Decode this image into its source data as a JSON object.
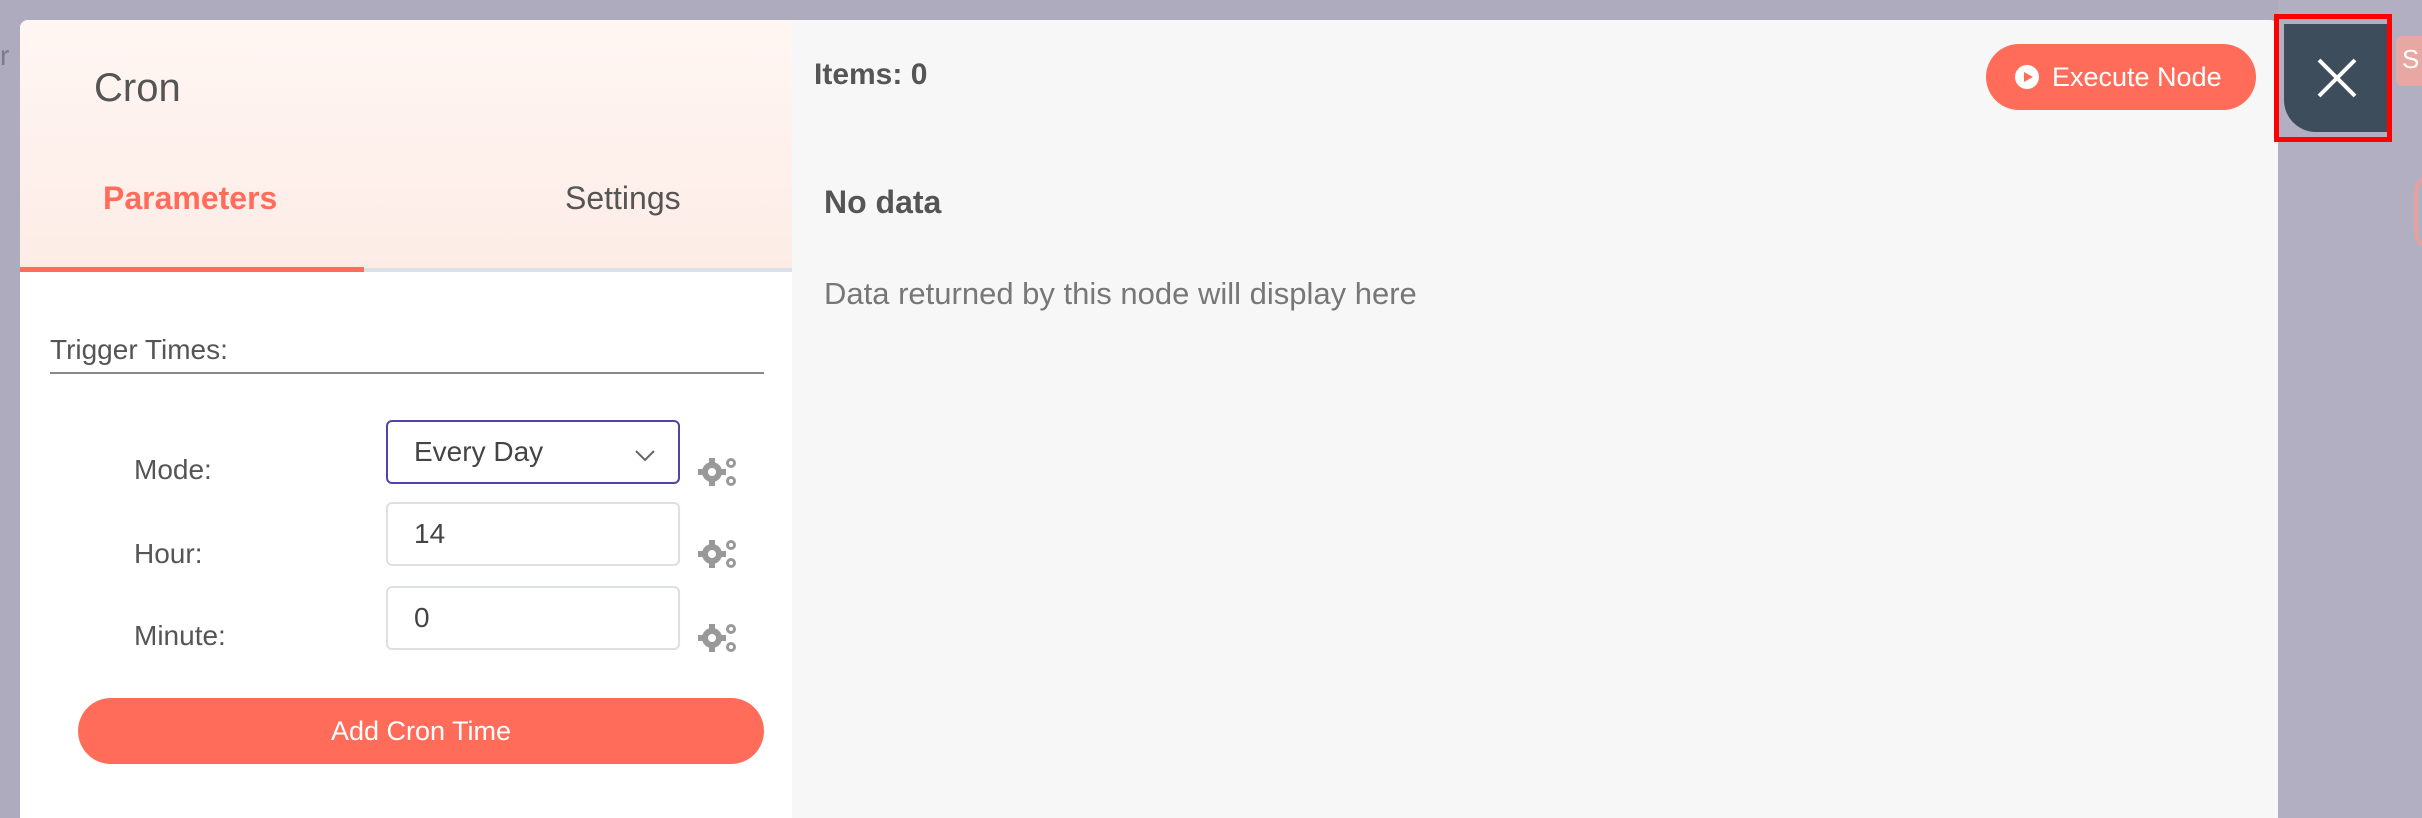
{
  "node": {
    "title": "Cron",
    "tabs": [
      {
        "label": "Parameters",
        "active": true
      },
      {
        "label": "Settings",
        "active": false
      }
    ]
  },
  "parameters": {
    "section_title": "Trigger Times:",
    "fields": [
      {
        "label": "Mode:",
        "value": "Every Day",
        "type": "select"
      },
      {
        "label": "Hour:",
        "value": "14",
        "type": "number"
      },
      {
        "label": "Minute:",
        "value": "0",
        "type": "number"
      }
    ],
    "add_button_label": "Add Cron Time"
  },
  "output": {
    "items_label": "Items: 0",
    "execute_label": "Execute Node",
    "no_data_title": "No data",
    "no_data_message": "Data returned by this node will display here"
  },
  "background": {
    "left_fragment": "r v",
    "right_fragment": "S"
  },
  "colors": {
    "accent": "#ff6d5a",
    "close_button": "#3e4d5c",
    "highlight": "#ff0000",
    "select_border": "#5145a8"
  },
  "icons": {
    "close": "close-icon",
    "play": "play-circle-icon",
    "gear": "gears-icon",
    "chevron": "chevron-down-icon"
  }
}
